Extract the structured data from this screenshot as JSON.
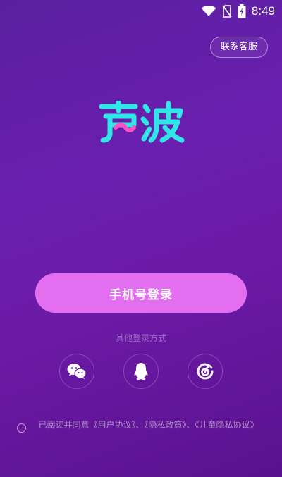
{
  "status_bar": {
    "time": "8:49",
    "icons": [
      "wifi-icon",
      "no-sim-icon",
      "battery-charging-icon"
    ]
  },
  "header": {
    "support_label": "联系客服"
  },
  "logo": {
    "text": "声波",
    "colors": {
      "primary": "#31e6e6",
      "accent": "#ff4fc4"
    }
  },
  "login": {
    "phone_label": "手机号登录",
    "button_color": "#e36ef0"
  },
  "other_login": {
    "label": "其他登录方式",
    "options": [
      "wechat-icon",
      "qq-icon",
      "netease-icon"
    ]
  },
  "agreement": {
    "text": "已阅读并同意《用户协议》、《隐私政策》、《儿童隐私协议》"
  }
}
